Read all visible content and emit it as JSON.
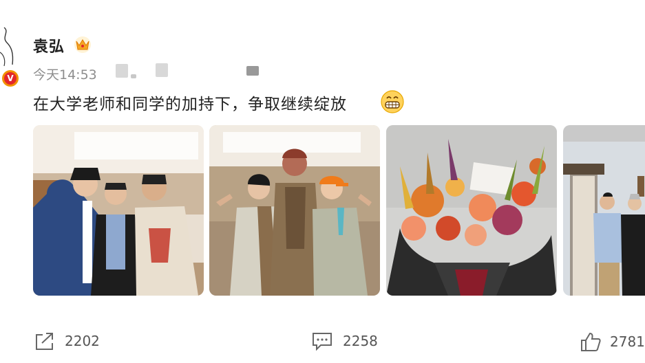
{
  "user": {
    "name": "袁弘",
    "timestamp": "今天14:53"
  },
  "post": {
    "text": "在大学老师和同学的加持下，争取继续绽放"
  },
  "photos": [
    {
      "icon": "group-photo-three-men"
    },
    {
      "icon": "group-photo-costume-actor"
    },
    {
      "icon": "flower-bouquet"
    },
    {
      "icon": "group-photo-two-men"
    }
  ],
  "actions": {
    "repost_count": "2202",
    "comment_count": "2258",
    "like_count": "2781"
  },
  "colors": {
    "verified_badge": "#e2262c",
    "badge_ring": "#f29100",
    "crown": "#f5a623",
    "meta_text": "#8d8d8d"
  }
}
